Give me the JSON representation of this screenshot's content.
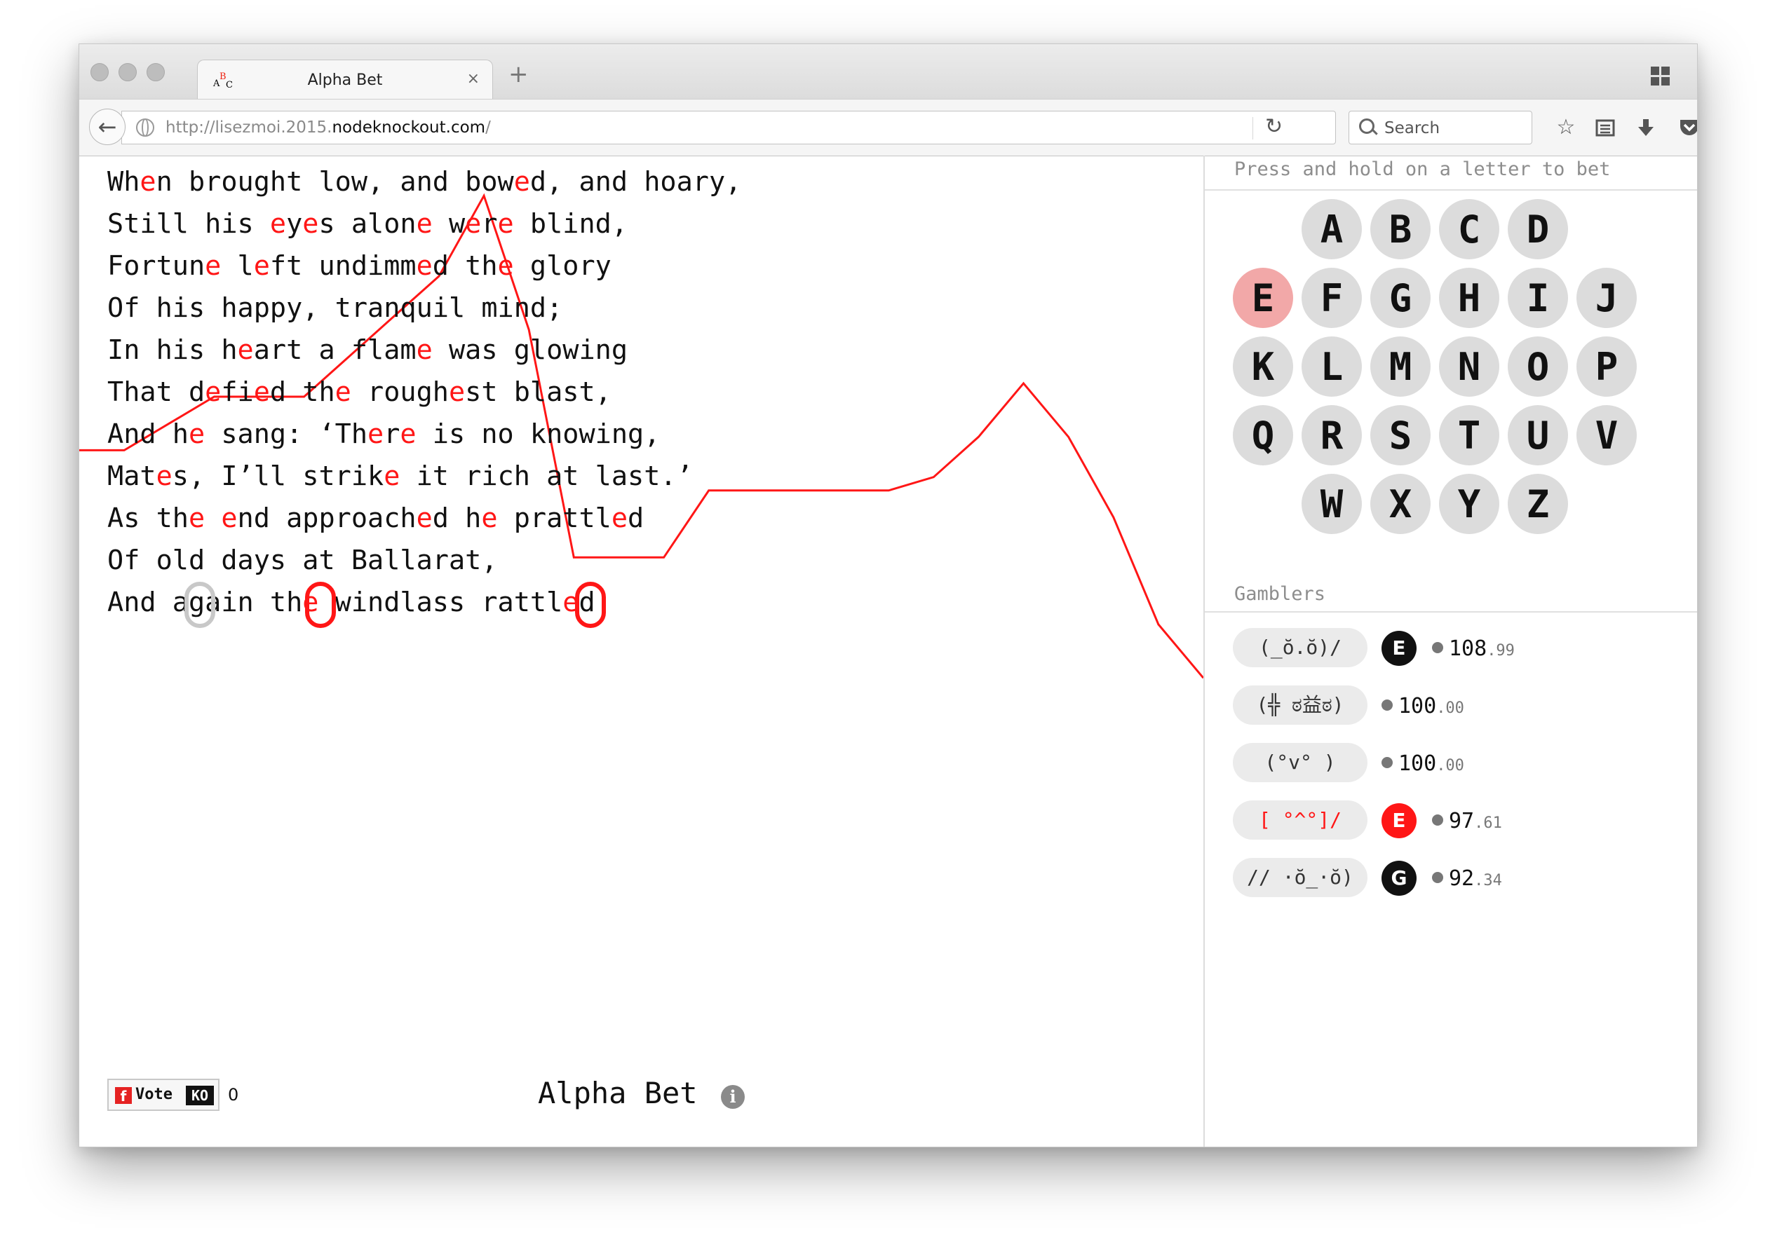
{
  "browser": {
    "tab_title": "Alpha Bet",
    "favicon_letters": [
      "A",
      "B",
      "C"
    ],
    "url_prefix": "http://lisezmoi.2015.",
    "url_host": "nodeknockout.com",
    "url_suffix": "/",
    "search_placeholder": "Search",
    "tab_close": "×",
    "new_tab": "+"
  },
  "poem": {
    "highlight_letter": "e",
    "lines": [
      "When brought low, and bowed, and hoary,",
      "Still his eyes alone were blind,",
      "Fortune left undimmed the glory",
      "Of his happy, tranquil mind;",
      "In his heart a flame was glowing",
      "That defied the roughest blast,",
      "And he sang: ‘There is no knowing,",
      "Mates, I’ll strike it rich at last.’",
      "As the end approached he prattled",
      "Of old days at Ballarat,",
      "And again the windlass rattled"
    ],
    "last_line_revealed": "And again the windlass rattled"
  },
  "footer": {
    "vote_label": "Vote",
    "vote_ko": "KO",
    "vote_count": "0",
    "title": "Alpha Bet",
    "info": "i"
  },
  "bet_panel": {
    "header": "Press and hold on a letter to bet",
    "letters": [
      "A",
      "B",
      "C",
      "D",
      "E",
      "F",
      "G",
      "H",
      "I",
      "J",
      "K",
      "L",
      "M",
      "N",
      "O",
      "P",
      "Q",
      "R",
      "S",
      "T",
      "U",
      "V",
      "W",
      "X",
      "Y",
      "Z"
    ],
    "selected_letter": "E",
    "gamblers_title": "Gamblers",
    "gamblers": [
      {
        "face": "(_ŏ.ŏ)/",
        "bet": "E",
        "bet_color": "black",
        "face_color": "default",
        "score_int": "108",
        "score_dec": ".99"
      },
      {
        "face": "(╬ ಠ益ಠ)",
        "bet": "",
        "bet_color": "none",
        "face_color": "default",
        "score_int": "100",
        "score_dec": ".00"
      },
      {
        "face": "(°v° )",
        "bet": "",
        "bet_color": "none",
        "face_color": "default",
        "score_int": "100",
        "score_dec": ".00"
      },
      {
        "face": "[ °^°]/",
        "bet": "E",
        "bet_color": "red",
        "face_color": "red",
        "score_int": "97",
        "score_dec": ".61"
      },
      {
        "face": "// ·ŏ_·ŏ)",
        "bet": "G",
        "bet_color": "black",
        "face_color": "default",
        "score_int": "92",
        "score_dec": ".34"
      }
    ]
  },
  "colors": {
    "accent": "#ff1616",
    "selected_letter_bg": "#f2a8a8",
    "letter_bg": "#dcdcdc"
  },
  "chart_data": {
    "type": "line",
    "x": [
      0,
      1,
      2,
      3,
      4,
      5,
      6,
      7,
      8,
      9,
      10,
      11,
      12,
      13,
      14,
      15,
      16,
      17,
      18,
      19,
      20,
      21,
      22,
      23,
      24,
      25
    ],
    "values": [
      108,
      108,
      110,
      112,
      112,
      112,
      115,
      118,
      121,
      127,
      117,
      100,
      100,
      100,
      105,
      105,
      105,
      105,
      105,
      106,
      109,
      113,
      109,
      103,
      95,
      91
    ],
    "series_color": "#ff1616",
    "ylim": [
      85,
      130
    ],
    "grid": false,
    "legend": "none"
  }
}
